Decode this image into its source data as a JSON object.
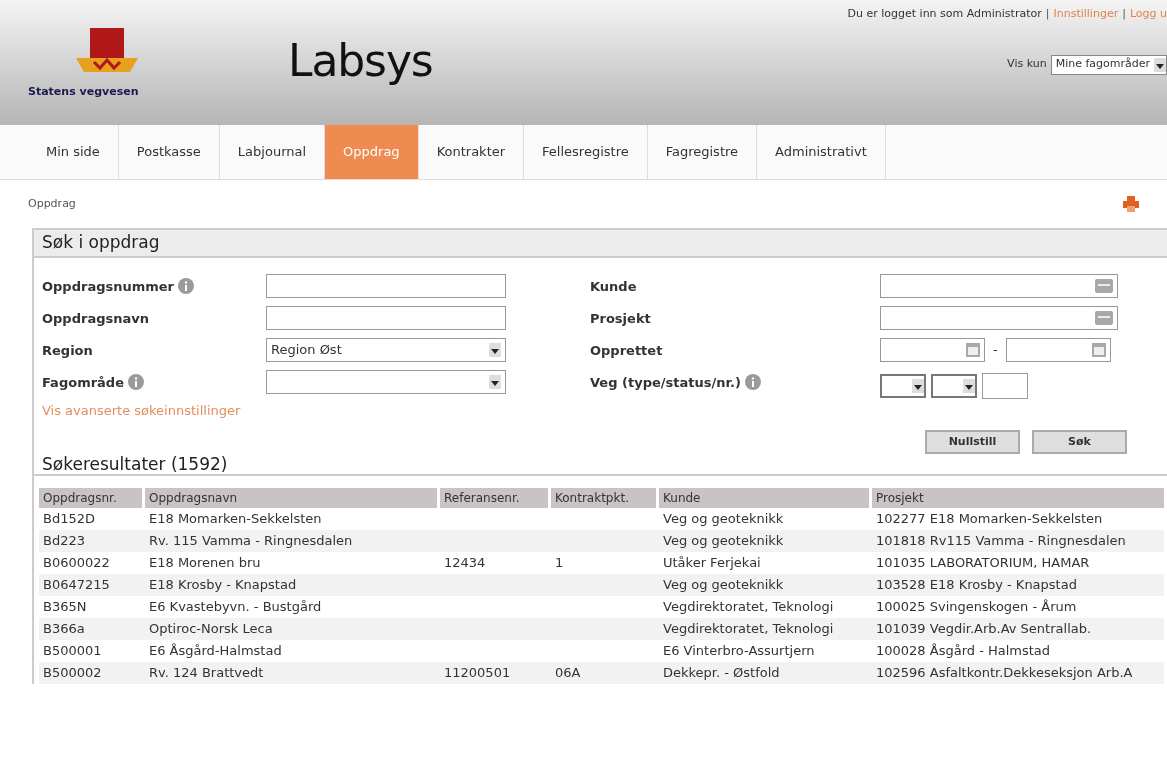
{
  "header": {
    "logo_text": "Statens vegvesen",
    "app_title": "Labsys",
    "user_text": "Du er logget inn som Administrator",
    "links": [
      "Innstillinger",
      "Logg u"
    ],
    "link_separator": "|",
    "filter_label": "Vis kun",
    "filter_value": "Mine fagområder"
  },
  "tabs": [
    {
      "label": "Min side",
      "selected": false
    },
    {
      "label": "Postkasse",
      "selected": false
    },
    {
      "label": "Labjournal",
      "selected": false
    },
    {
      "label": "Oppdrag",
      "selected": true
    },
    {
      "label": "Kontrakter",
      "selected": false
    },
    {
      "label": "Fellesregistre",
      "selected": false
    },
    {
      "label": "Fagregistre",
      "selected": false
    },
    {
      "label": "Administrativt",
      "selected": false
    }
  ],
  "breadcrumb": "Oppdrag",
  "search": {
    "title": "Søk i oppdrag",
    "left_fields": [
      {
        "label": "Oppdragsnummer",
        "kind": "text",
        "info": true
      },
      {
        "label": "Oppdragsnavn",
        "kind": "text",
        "info": false
      },
      {
        "label": "Region",
        "kind": "select",
        "value": "Region Øst",
        "info": false
      },
      {
        "label": "Fagområde",
        "kind": "select",
        "info": true
      }
    ],
    "right_fields": [
      {
        "label": "Kunde",
        "kind": "lookup",
        "info": false
      },
      {
        "label": "Prosjekt",
        "kind": "lookup",
        "info": false
      },
      {
        "label": "Opprettet",
        "kind": "daterange",
        "separator": "-",
        "info": false
      },
      {
        "label": "Veg (type/status/nr.)",
        "kind": "road",
        "info": true
      }
    ],
    "advanced_link": "Vis avanserte søkeinnstillinger",
    "buttons": [
      "Nullstill",
      "Søk"
    ]
  },
  "results": {
    "title": "Søkeresultater (1592)",
    "columns": [
      "Oppdragsnr.",
      "Oppdragsnavn",
      "Referansenr.",
      "Kontraktpkt.",
      "Kunde",
      "Prosjekt"
    ],
    "rows": [
      [
        "Bd152D",
        "E18 Momarken-Sekkelsten",
        "",
        "",
        "Veg og geoteknikk",
        "102277 E18 Momarken-Sekkelsten"
      ],
      [
        "Bd223",
        "Rv. 115 Vamma - Ringnesdalen",
        "",
        "",
        "Veg og geoteknikk",
        "101818 Rv115 Vamma - Ringnesdalen"
      ],
      [
        "B0600022",
        "E18 Morenen bru",
        "12434",
        "1",
        "Utåker Ferjekai",
        "101035 LABORATORIUM, HAMAR"
      ],
      [
        "B0647215",
        "E18 Krosby - Knapstad",
        "",
        "",
        "Veg og geoteknikk",
        "103528 E18 Krosby - Knapstad"
      ],
      [
        "B365N",
        "E6 Kvastebyvn. - Bustgård",
        "",
        "",
        "Vegdirektoratet, Teknologi",
        "100025 Svingenskogen - Årum"
      ],
      [
        "B366a",
        "Optiroc-Norsk Leca",
        "",
        "",
        "Vegdirektoratet, Teknologi",
        "101039 Vegdir.Arb.Av Sentrallab."
      ],
      [
        "B500001",
        "E6 Åsgård-Halmstad",
        "",
        "",
        "E6 Vinterbro-Assurtjern",
        "100028 Åsgård - Halmstad"
      ],
      [
        "B500002",
        "Rv. 124 Brattvedt",
        "11200501",
        "06A",
        "Dekkepr. - Østfold",
        "102596 Asfaltkontr.Dekkeseksjon Arb.A"
      ]
    ]
  }
}
